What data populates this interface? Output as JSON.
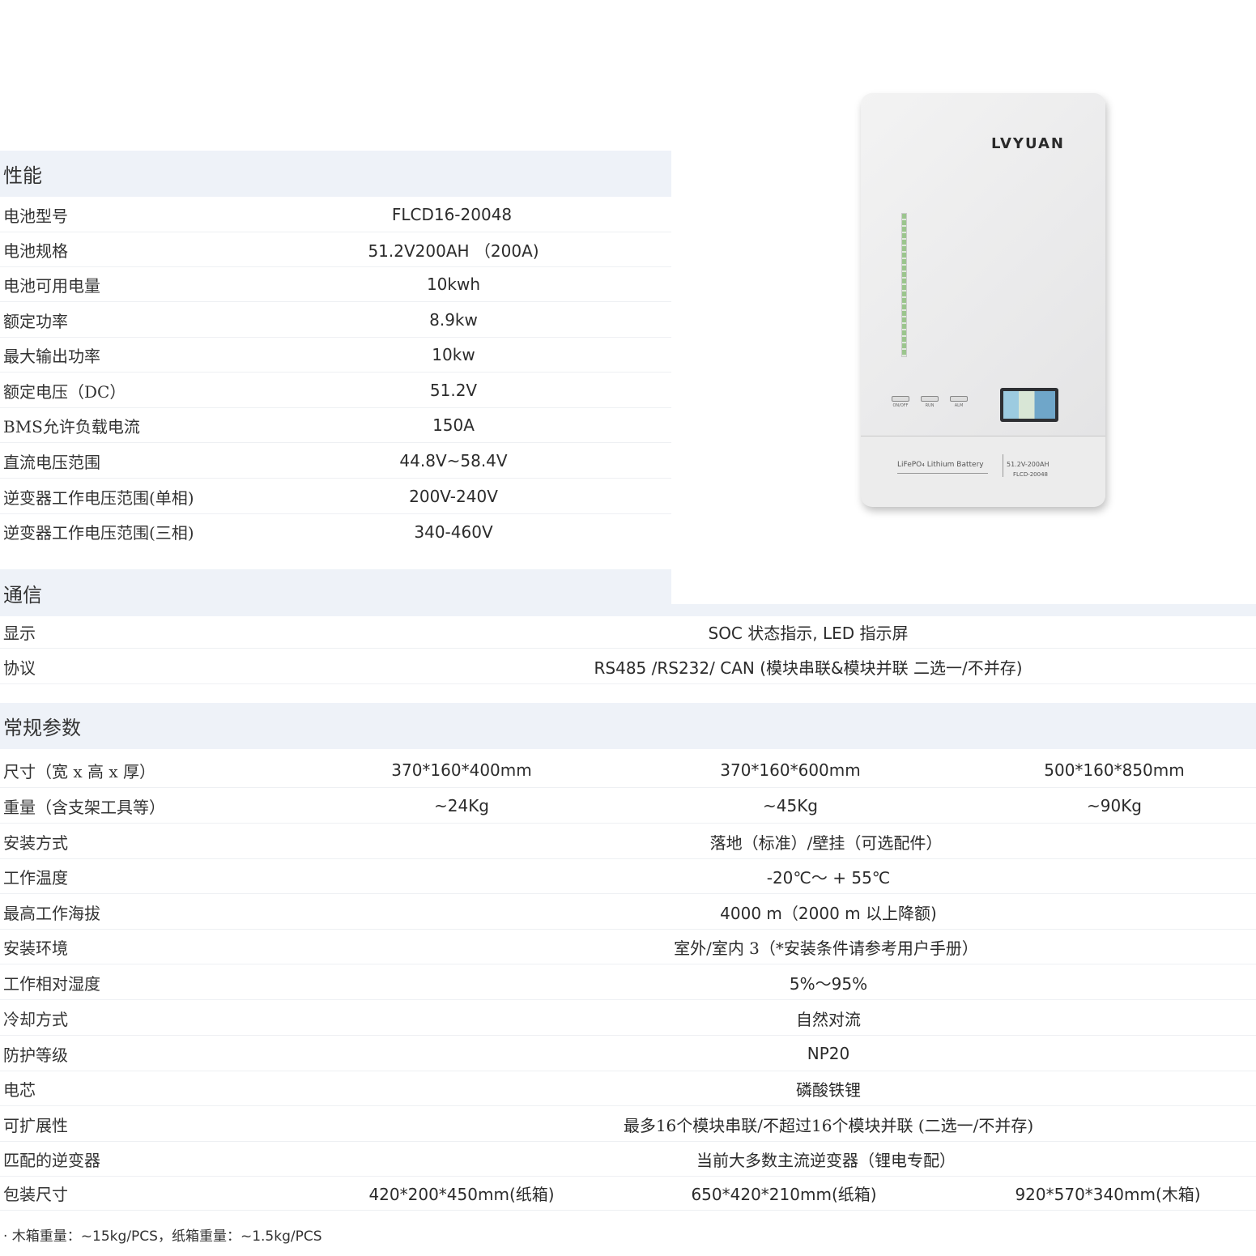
{
  "sections": {
    "performance": "性能",
    "communication": "通信",
    "general": "常规参数"
  },
  "performance_rows": [
    {
      "label": "电池型号",
      "value": "FLCD16-20048"
    },
    {
      "label": "电池规格",
      "value": "51.2V200AH （200A)"
    },
    {
      "label": "电池可用电量",
      "value": "10kwh"
    },
    {
      "label": "额定功率",
      "value": "8.9kw"
    },
    {
      "label": "最大输出功率",
      "value": "10kw"
    },
    {
      "label": "额定电压（DC）",
      "value": "51.2V"
    },
    {
      "label": "BMS允许负载电流",
      "value": "150A"
    },
    {
      "label": "直流电压范围",
      "value": "44.8V~58.4V"
    },
    {
      "label": "逆变器工作电压范围(单相)",
      "value": "200V-240V"
    },
    {
      "label": "逆变器工作电压范围(三相)",
      "value": "340-460V"
    }
  ],
  "communication_rows": [
    {
      "label": "显示",
      "value": "SOC 状态指示, LED 指示屏"
    },
    {
      "label": "协议",
      "value": "RS485 /RS232/ CAN (模块串联&模块并联 二选一/不并存)"
    }
  ],
  "general_rows": {
    "size": {
      "label": "尺寸（宽 x 高 x 厚）",
      "v1": "370*160*400mm",
      "v2": "370*160*600mm",
      "v3": "500*160*850mm"
    },
    "weight": {
      "label": "重量（含支架工具等）",
      "v1": "~24Kg",
      "v2": "~45Kg",
      "v3": "~90Kg"
    },
    "install": {
      "label": "安装方式",
      "value": "落地（标准）/壁挂（可选配件）"
    },
    "temp": {
      "label": "工作温度",
      "value": "-20℃～ + 55℃"
    },
    "altitude": {
      "label": "最高工作海拔",
      "value": "4000 m（2000 m 以上降额)"
    },
    "env": {
      "label": "安装环境",
      "value": "室外/室内 3（*安装条件请参考用户手册）"
    },
    "humidity": {
      "label": "工作相对湿度",
      "value": "5%～95%"
    },
    "cooling": {
      "label": "冷却方式",
      "value": "自然对流"
    },
    "protection": {
      "label": "防护等级",
      "value": "NP20"
    },
    "cell": {
      "label": "电芯",
      "value": "磷酸铁锂"
    },
    "scalability": {
      "label": "可扩展性",
      "value": "最多16个模块串联/不超过16个模块并联 (二选一/不并存)"
    },
    "inverter": {
      "label": "匹配的逆变器",
      "value": "当前大多数主流逆变器（锂电专配）"
    },
    "package": {
      "label": "包装尺寸",
      "v1": "420*200*450mm(纸箱)",
      "v2": "650*420*210mm(纸箱)",
      "v3": "920*570*340mm(木箱)"
    }
  },
  "note": "· 木箱重量：~15kg/PCS，纸箱重量：~1.5kg/PCS",
  "product": {
    "logo": "LVYUAN",
    "btn1": "ON/OFF",
    "btn2": "RUN",
    "btn3": "ALM",
    "label_left": "LiFePO₄ Lithium Battery",
    "label_right1": "51.2V-200AH",
    "label_right2": "FLCD-20048"
  }
}
